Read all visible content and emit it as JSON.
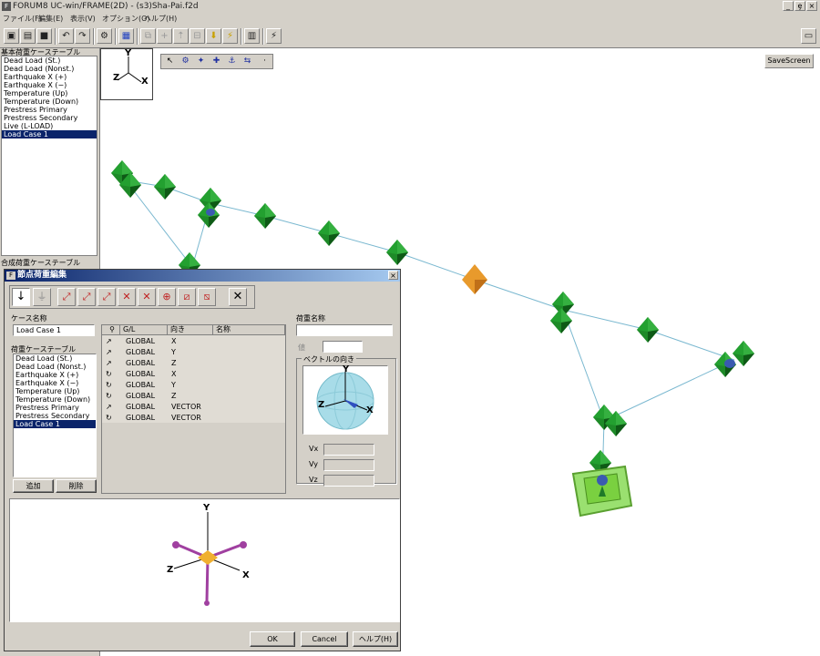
{
  "window": {
    "title": "FORUM8 UC-win/FRAME(2D) - (s3)Sha-Pai.f2d",
    "icon": "app-icon",
    "controls": [
      "_",
      "ȩ",
      "×"
    ]
  },
  "menu": [
    "ファイル(F)",
    "編集(E)",
    "表示(V)",
    "オプション(O)",
    "ヘルプ(H)"
  ],
  "toolbar": {
    "icons": [
      "new-icon",
      "open-icon",
      "save-icon",
      "undo-icon",
      "redo-icon",
      "calc-icon",
      "grid-icon",
      "copy-icon",
      "add-node-icon",
      "support-icon",
      "member-icon",
      "load-icon",
      "check-icon",
      "report-icon",
      "chart-icon",
      "window-icon"
    ]
  },
  "left_panel": {
    "basic_table_label": "基本荷重ケーステーブル",
    "basic_cases": [
      "Dead Load (St.)",
      "Dead Load (Nonst.)",
      "Earthquake X (+)",
      "Earthquake X (−)",
      "Temperature (Up)",
      "Temperature (Down)",
      "Prestress Primary",
      "Prestress Secondary",
      "Live (L-LOAD)",
      "Load Case 1"
    ],
    "selected_index": 9,
    "combo_table_label": "合成荷重ケーステーブル"
  },
  "viewport": {
    "axes": {
      "y": "Y",
      "z": "Z",
      "x": "X"
    },
    "tools": [
      "↖",
      "⚙",
      "✦",
      "✚",
      "⚓",
      "⇆",
      "·"
    ],
    "save_screen": "SaveScreen"
  },
  "dialog": {
    "title": "節点荷重編集",
    "close": "×",
    "case_name_label": "ケース名称",
    "case_name_value": "Load Case 1",
    "load_table_label": "荷重ケーステーブル",
    "load_cases": [
      "Dead Load (St.)",
      "Dead Load (Nonst.)",
      "Earthquake X (+)",
      "Earthquake X (−)",
      "Temperature (Up)",
      "Temperature (Down)",
      "Prestress Primary",
      "Prestress Secondary",
      "Load Case 1"
    ],
    "load_selected_index": 8,
    "add_button": "追加",
    "delete_button": "削除",
    "grid": {
      "headers": [
        "",
        "G/L",
        "向き",
        "名称"
      ],
      "rows": [
        {
          "icon": "↗",
          "gl": "GLOBAL",
          "dir": "X"
        },
        {
          "icon": "↗",
          "gl": "GLOBAL",
          "dir": "Y"
        },
        {
          "icon": "↗",
          "gl": "GLOBAL",
          "dir": "Z"
        },
        {
          "icon": "↻",
          "gl": "GLOBAL",
          "dir": "X"
        },
        {
          "icon": "↻",
          "gl": "GLOBAL",
          "dir": "Y"
        },
        {
          "icon": "↻",
          "gl": "GLOBAL",
          "dir": "Z"
        },
        {
          "icon": "↗",
          "gl": "GLOBAL",
          "dir": "VECTOR"
        },
        {
          "icon": "↻",
          "gl": "GLOBAL",
          "dir": "VECTOR"
        }
      ]
    },
    "load_name_label": "荷重名称",
    "value_label": "値",
    "vector_label": "ベクトルの向き",
    "sphere_axes": {
      "y": "Y",
      "z": "Z",
      "x": "X"
    },
    "vx_label": "Vx",
    "vy_label": "Vy",
    "vz_label": "Vz",
    "preview_axes": {
      "y": "Y",
      "z": "Z",
      "x": "X"
    },
    "ok_button": "OK",
    "cancel_button": "Cancel",
    "help_button": "ヘルプ(H)"
  },
  "colors": {
    "node_green": "#1f8a2a",
    "node_orange": "#e89a2c",
    "member_line": "#7ab8d0",
    "support_green": "#7ad040",
    "selection_blue": "#0a246a"
  }
}
